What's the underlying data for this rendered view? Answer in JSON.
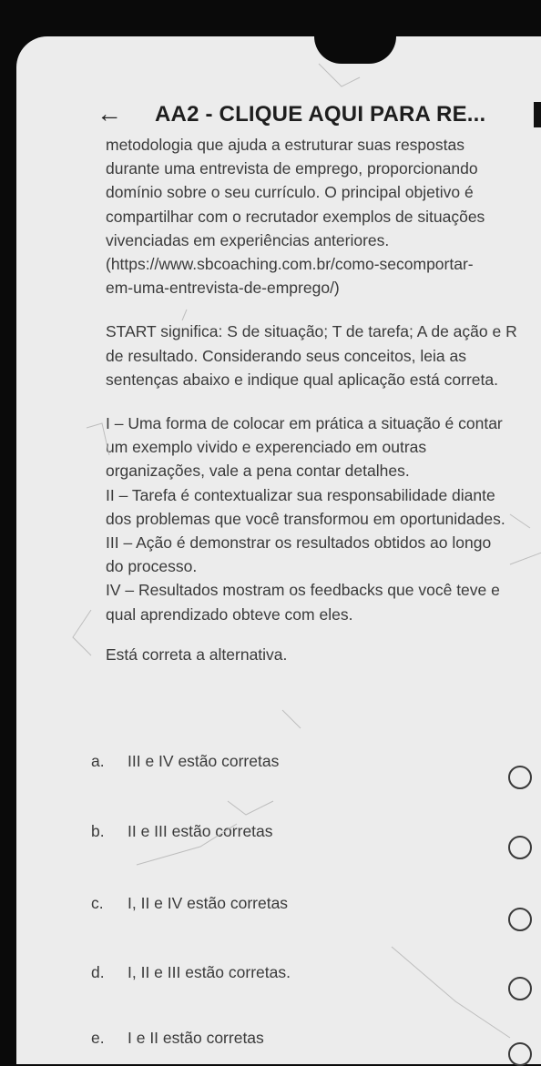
{
  "header": {
    "title": "AA2 - CLIQUE AQUI PARA RE...",
    "back_icon": "arrow-left-icon"
  },
  "question": {
    "intro_lines": [
      "metodologia que ajuda a estruturar suas respostas",
      "durante uma entrevista de emprego, proporcionando",
      "domínio sobre o seu currículo. O principal objetivo é",
      "compartilhar com o recrutador exemplos de situações",
      "vivenciadas em experiências anteriores.",
      "(https://www.sbcoaching.com.br/como-secomportar-",
      "em-uma-entrevista-de-emprego/)"
    ],
    "star_lines": [
      "START significa: S de situação; T de tarefa; A de ação e R",
      "de resultado. Considerando seus conceitos, leia as",
      "sentenças abaixo e indique qual aplicação está correta."
    ],
    "statements": [
      "I – Uma forma de colocar em prática a situação é contar",
      "um exemplo vivido e experenciado em outras",
      "organizações, vale a pena contar detalhes.",
      "II – Tarefa é contextualizar sua responsabilidade diante",
      "dos problemas que você transformou em oportunidades.",
      "III – Ação é demonstrar os resultados obtidos ao longo",
      "do processo.",
      "IV – Resultados mostram os feedbacks que você teve e",
      "qual aprendizado obteve com eles."
    ],
    "prompt": "Está correta a alternativa."
  },
  "options": [
    {
      "letter": "a.",
      "text": "III e IV estão corretas"
    },
    {
      "letter": "b.",
      "text": "II e III estão corretas"
    },
    {
      "letter": "c.",
      "text": "I, II e IV estão corretas"
    },
    {
      "letter": "d.",
      "text": "I, II e III estão corretas."
    },
    {
      "letter": "e.",
      "text": "I e II estão corretas"
    }
  ]
}
